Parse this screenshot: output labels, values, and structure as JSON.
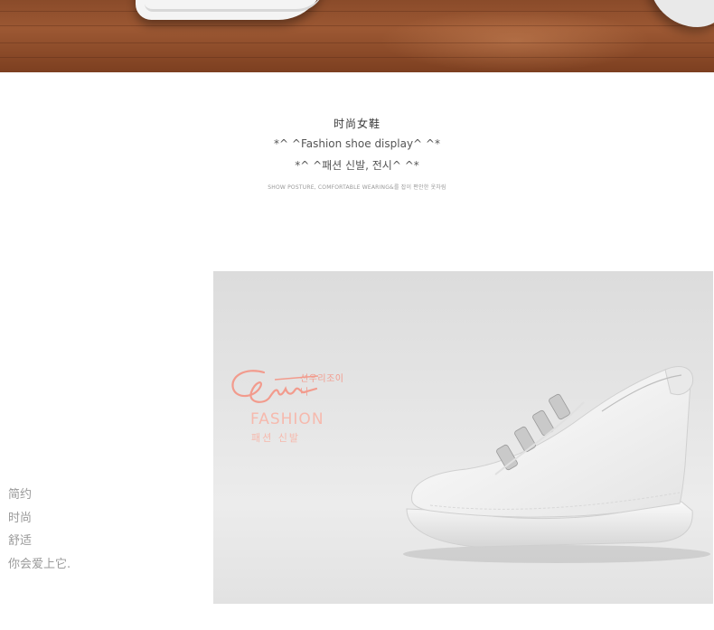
{
  "intro": {
    "title": "时尚女鞋",
    "line1": "*^  ^Fashion shoe display^  ^*",
    "line2": "*^  ^패션 신발, 전시^  ^*",
    "tagline": "SHOW POSTURE, COMFORTABLE WEARING&를 잡이 편안한 옷차림"
  },
  "side_text": [
    "简约",
    "时尚",
    "舒适",
    "你会爱上它."
  ],
  "brand": {
    "logo_text": "선우리조이니",
    "fashion": "FASHION",
    "fashion_ko": "패션 신발"
  },
  "colors": {
    "accent": "#f29b8d",
    "wood": "#9c5833"
  },
  "icons": [
    "shoe-photo",
    "brand-signature-logo"
  ]
}
